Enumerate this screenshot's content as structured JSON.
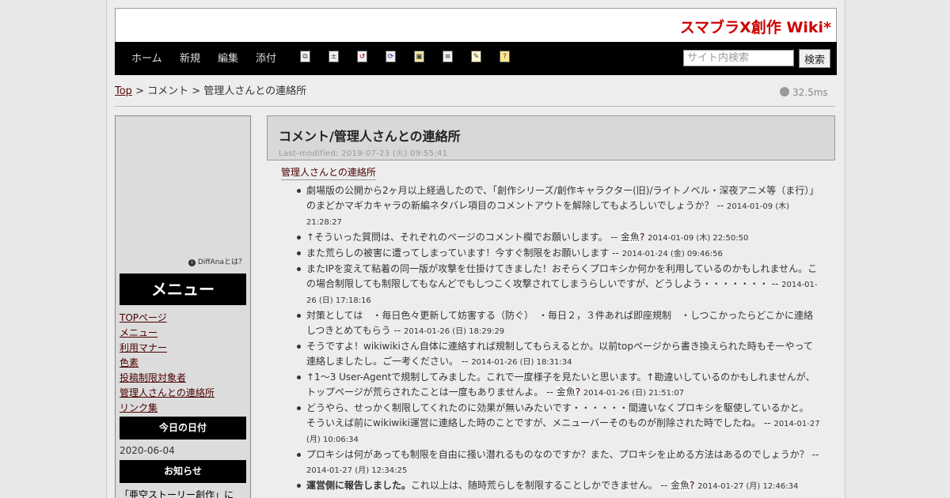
{
  "site_title": "スマブラX創作 Wiki*",
  "nav": {
    "home": "ホーム",
    "new": "新規",
    "edit": "編集",
    "attach": "添付"
  },
  "toolbar_icons": [
    "copy-icon",
    "diff-icon",
    "backup-icon",
    "reload-icon",
    "freeze-icon",
    "list-icon",
    "recent-icon",
    "help-icon"
  ],
  "search": {
    "placeholder": "サイト内検索",
    "button": "検索"
  },
  "breadcrumb": {
    "top": "Top",
    "sep1": " > ",
    "comment": "コメント",
    "sep2": " > ",
    "current": "管理人さんとの連絡所"
  },
  "timing": "32.5ms",
  "sidebar": {
    "diffana": "DiffAnaとは？",
    "menu_title": "メニュー",
    "links": [
      "TOPページ",
      "メニュー",
      "利用マナー",
      "色素",
      "投稿制限対象者",
      "管理人さんとの連絡所",
      "リンク集"
    ],
    "today_title": "今日の日付",
    "today_date": "2020-06-04",
    "notice_title": "お知らせ",
    "notice_item": "「亜空ストーリー創作」に"
  },
  "page": {
    "title": "コメント/管理人さんとの連絡所",
    "last_modified": "Last-modified: 2019-07-23 (火) 09:55:41",
    "section_heading": "管理人さんとの連絡所"
  },
  "comments": [
    {
      "text": "劇場版の公開から2ヶ月以上経過したので、「創作シリーズ/創作キャラクター(旧)/ライトノベル・深夜アニメ等（ま行）」のまどかマギカキャラの新編ネタバレ項目のコメントアウトを解除してもよろしいでしょうか？",
      "sep": " -- ",
      "stamp": "2014-01-09 (木) 21:28:27"
    },
    {
      "text": "↑そういった質問は、それぞれのページのコメント欄でお願いします。",
      "sep": " -- ",
      "author": "金魚",
      "q": "?",
      "stamp": "2014-01-09 (木) 22:50:50"
    },
    {
      "text": "また荒らしの被害に遭ってしまっています！今すぐ制限をお願いします",
      "sep": " -- ",
      "stamp": "2014-01-24 (金) 09:46:56"
    },
    {
      "text": "またIPを変えて粘着の同一版が攻撃を仕掛けてきました！おそらくプロキシか何かを利用しているのかもしれません。この場合制限しても制限してもなんどでもしつこく攻撃されてしまうらしいですが、どうしよう・・・・・・・",
      "sep": " -- ",
      "stamp": "2014-01-26 (日) 17:18:16"
    },
    {
      "text": "対策としては　・毎日色々更新して妨害する（防ぐ）　・毎日２，３件あれば即座規制　・しつこかったらどこかに連絡しつきとめてもらう",
      "sep": " -- ",
      "stamp": "2014-01-26 (日) 18:29:29"
    },
    {
      "text": "そうですよ！wikiwikiさん自体に連絡すれば規制してもらえるとか。以前topページから書き換えられた時もそーやって連絡しましたし。ご一考ください。",
      "sep": " -- ",
      "stamp": "2014-01-26 (日) 18:31:34"
    },
    {
      "text": "↑1～3 User-Agentで規制してみました。これで一度様子を見たいと思います。↑勘違いしているのかもしれませんが、トップページが荒らされたことは一度もありませんよ。",
      "sep": " -- ",
      "author": "金魚",
      "q": "?",
      "stamp": "2014-01-26 (日) 21:51:07"
    },
    {
      "text": "どうやら、せっかく制限してくれたのに効果が無いみたいです・・・・・・間違いなくプロキシを駆使しているかと。",
      "text2": "そういえば前にwikiwiki運営に連絡した時のことですが、メニューバーそのものが削除された時でしたね。",
      "sep": " -- ",
      "stamp": "2014-01-27 (月) 10:06:34"
    },
    {
      "text": "プロキシは何があっても制限を自由に掻い潜れるものなのですか？また、プロキシを止める方法はあるのでしょうか？",
      "sep": " -- ",
      "stamp": "2014-01-27 (月) 12:34:25"
    },
    {
      "strong": "運営側に報告しました。",
      "text": "これ以上は、随時荒らしを制限することしかできません。",
      "sep": " -- ",
      "author": "金魚",
      "q": "?",
      "stamp": "2014-01-27 (月) 12:46:34"
    }
  ]
}
